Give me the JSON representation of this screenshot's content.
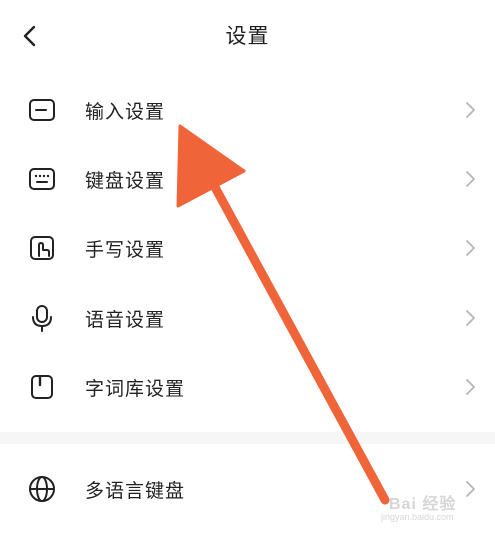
{
  "header": {
    "title": "设置",
    "back_icon": "chevron-left-icon"
  },
  "menu": [
    {
      "label": "输入设置",
      "icon": "message-box-icon"
    },
    {
      "label": "键盘设置",
      "icon": "keyboard-icon"
    },
    {
      "label": "手写设置",
      "icon": "handwriting-icon"
    },
    {
      "label": "语音设置",
      "icon": "microphone-icon"
    },
    {
      "label": "字词库设置",
      "icon": "bookmark-icon"
    },
    {
      "label": "多语言键盘",
      "icon": "globe-icon"
    }
  ],
  "overlay": {
    "arrow_color": "#f0643a"
  },
  "watermark": {
    "text": "Bai 经验",
    "url": "jingyan.baidu.com"
  }
}
